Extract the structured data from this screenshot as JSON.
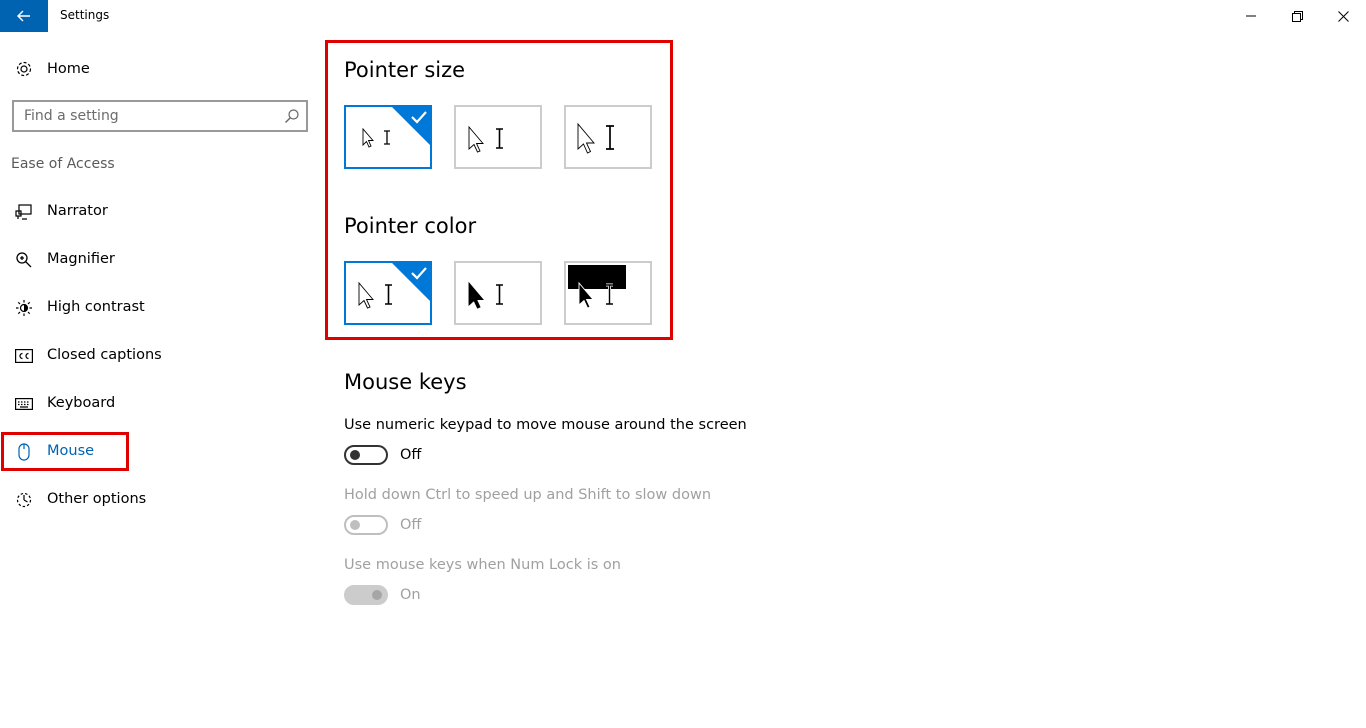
{
  "window": {
    "title": "Settings"
  },
  "sidebar": {
    "home_label": "Home",
    "search_placeholder": "Find a setting",
    "section_label": "Ease of Access",
    "items": [
      {
        "label": "Narrator",
        "icon": "narrator-icon"
      },
      {
        "label": "Magnifier",
        "icon": "magnifier-icon"
      },
      {
        "label": "High contrast",
        "icon": "high-contrast-icon"
      },
      {
        "label": "Closed captions",
        "icon": "closed-captions-icon"
      },
      {
        "label": "Keyboard",
        "icon": "keyboard-icon"
      },
      {
        "label": "Mouse",
        "icon": "mouse-icon",
        "selected": true
      },
      {
        "label": "Other options",
        "icon": "other-options-icon"
      }
    ]
  },
  "main": {
    "pointer_size": {
      "heading": "Pointer size",
      "selected_index": 0,
      "options": [
        "small",
        "medium",
        "large"
      ]
    },
    "pointer_color": {
      "heading": "Pointer color",
      "selected_index": 0,
      "options": [
        "white",
        "black",
        "inverted"
      ]
    },
    "mouse_keys": {
      "heading": "Mouse keys",
      "settings": [
        {
          "label": "Use numeric keypad to move mouse around the screen",
          "state": "Off",
          "enabled": true
        },
        {
          "label": "Hold down Ctrl to speed up and Shift to slow down",
          "state": "Off",
          "enabled": false
        },
        {
          "label": "Use mouse keys when Num Lock is on",
          "state": "On",
          "enabled": false
        }
      ]
    }
  },
  "colors": {
    "accent": "#0078d7",
    "back_button": "#0063b1",
    "highlight": "#e00000"
  }
}
